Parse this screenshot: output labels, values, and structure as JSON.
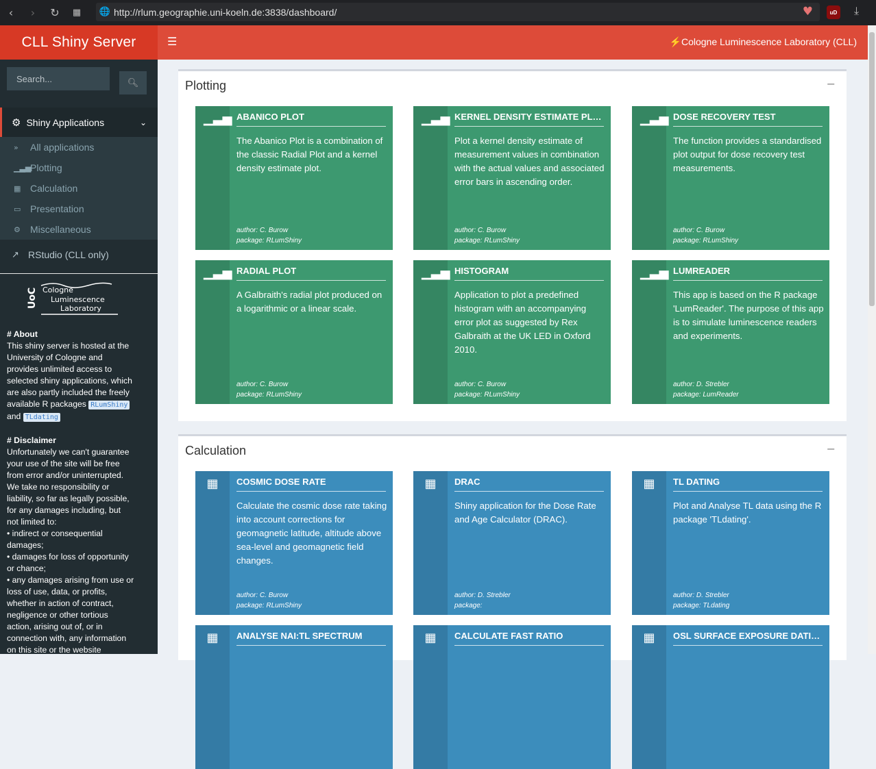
{
  "browser": {
    "url": "http://rlum.geographie.uni-koeln.de:3838/dashboard/",
    "ublock_label": "uD"
  },
  "header": {
    "logo": "CLL Shiny Server",
    "right_text": "Cologne Luminescence Laboratory (CLL)"
  },
  "sidebar": {
    "search_placeholder": "Search...",
    "main_item": "Shiny Applications",
    "sub_items": [
      {
        "label": "All applications",
        "icon": "angle-double-right-icon"
      },
      {
        "label": "Plotting",
        "icon": "bar-chart-icon"
      },
      {
        "label": "Calculation",
        "icon": "calculator-icon"
      },
      {
        "label": "Presentation",
        "icon": "desktop-icon"
      },
      {
        "label": "Miscellaneous",
        "icon": "cogs-icon"
      }
    ],
    "rstudio": "RStudio (CLL only)",
    "logo_text": [
      "Cologne",
      "Luminescence",
      "Laboratory"
    ],
    "logo_side": "UoC",
    "about_heading": "# About",
    "about_text": "This shiny server is hosted at the University of Cologne and provides unlimited access to selected shiny applications, which are also partly included the freely available R packages",
    "about_pkg1": "RLumShiny",
    "about_and": "and",
    "about_pkg2": "TLdating",
    "disclaimer_heading": "# Disclaimer",
    "disclaimer_text": "Unfortunately we can't guarantee your use of the site will be free from error and/or uninterrupted. We take no responsibility or liability, so far as legally possible, for any damages including, but not limited to:",
    "disclaimer_bullets": [
      "• indirect or consequential damages;",
      "• damages for loss of opportunity or chance;",
      "• any damages arising from use or loss of use, data, or profits, whether in action of contract, negligence or other tortious action, arising out of, or in connection with, any information on this site or the website"
    ]
  },
  "sections": [
    {
      "title": "Plotting",
      "collapse": "−",
      "cards": [
        {
          "title": "ABANICO PLOT",
          "desc": "The Abanico Plot is a combination of the classic Radial Plot and a kernel density estimate plot.",
          "author": "author: C. Burow",
          "package": "package: RLumShiny"
        },
        {
          "title": "KERNEL DENSITY ESTIMATE PLOT",
          "desc": "Plot a kernel density estimate of measurement values in combination with the actual values and associated error bars in ascending order.",
          "author": "author: C. Burow",
          "package": "package: RLumShiny"
        },
        {
          "title": "DOSE RECOVERY TEST",
          "desc": "The function provides a standardised plot output for dose recovery test measurements.",
          "author": "author: C. Burow",
          "package": "package: RLumShiny"
        },
        {
          "title": "RADIAL PLOT",
          "desc": "A Galbraith's radial plot produced on a logarithmic or a linear scale.",
          "author": "author: C. Burow",
          "package": "package: RLumShiny"
        },
        {
          "title": "HISTOGRAM",
          "desc": "Application to plot a predefined histogram with an accompanying error plot as suggested by Rex Galbraith at the UK LED in Oxford 2010.",
          "author": "author: C. Burow",
          "package": "package: RLumShiny"
        },
        {
          "title": "LUMREADER",
          "desc": "This app is based on the R package 'LumReader'. The purpose of this app is to simulate luminescence readers and experiments.",
          "author": "author: D. Strebler",
          "package": "package: LumReader"
        }
      ]
    },
    {
      "title": "Calculation",
      "collapse": "−",
      "cards": [
        {
          "title": "COSMIC DOSE RATE",
          "desc": "Calculate the cosmic dose rate taking into account corrections for geomagnetic latitude, altitude above sea-level and geomagnetic field changes.",
          "author": "author: C. Burow",
          "package": "package: RLumShiny"
        },
        {
          "title": "DRAC",
          "desc": "Shiny application for the Dose Rate and Age Calculator (DRAC).",
          "author": "author: D. Strebler",
          "package": "package:"
        },
        {
          "title": "TL DATING",
          "desc": "Plot and Analyse TL data using the R package 'TLdating'.",
          "author": "author: D. Strebler",
          "package": "package: TLdating"
        },
        {
          "title": "ANALYSE NAI:TL SPECTRUM",
          "desc": "",
          "author": "",
          "package": ""
        },
        {
          "title": "CALCULATE FAST RATIO",
          "desc": "",
          "author": "",
          "package": ""
        },
        {
          "title": "OSL SURFACE EXPOSURE DATING ...",
          "desc": "",
          "author": "",
          "package": ""
        }
      ]
    }
  ],
  "colors": {
    "green": "#3d9970",
    "blue": "#3c8dbc",
    "header": "#dd4b39",
    "sidebar": "#222d32"
  }
}
